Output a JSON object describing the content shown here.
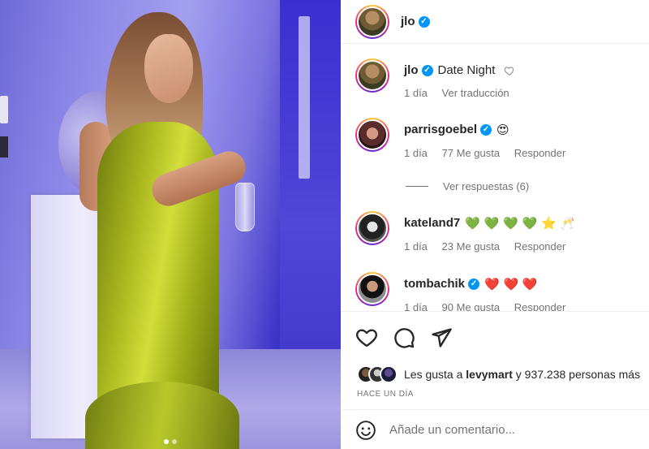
{
  "post": {
    "author": "jlo",
    "caption_username": "jlo",
    "caption": "Date Night",
    "caption_time": "1 día",
    "translate_label": "Ver traducción"
  },
  "comments": [
    {
      "username": "parrisgoebel",
      "verified": true,
      "text": "😍",
      "time": "1 día",
      "likes": "77 Me gusta",
      "reply": "Responder"
    },
    {
      "username": "kateland7",
      "verified": false,
      "text": "💚 💚 💚 💚 ⭐ 🥂",
      "time": "1 día",
      "likes": "23 Me gusta",
      "reply": "Responder"
    },
    {
      "username": "tombachik",
      "verified": true,
      "text": "❤️ ❤️ ❤️",
      "time": "1 día",
      "likes": "90 Me gusta",
      "reply": "Responder"
    }
  ],
  "view_replies": "Ver respuestas (6)",
  "likes": {
    "prefix": "Les gusta a",
    "user": "levymart",
    "suffix": "y 937.238 personas más"
  },
  "timestamp": "HACE UN DÍA",
  "add_comment_placeholder": "Añade un comentario...",
  "colors": {
    "verified": "#0095f6",
    "muted": "#737373",
    "text": "#262626"
  },
  "icons": [
    "heart-icon",
    "comment-icon",
    "share-icon",
    "emoji-icon",
    "verified-icon"
  ]
}
